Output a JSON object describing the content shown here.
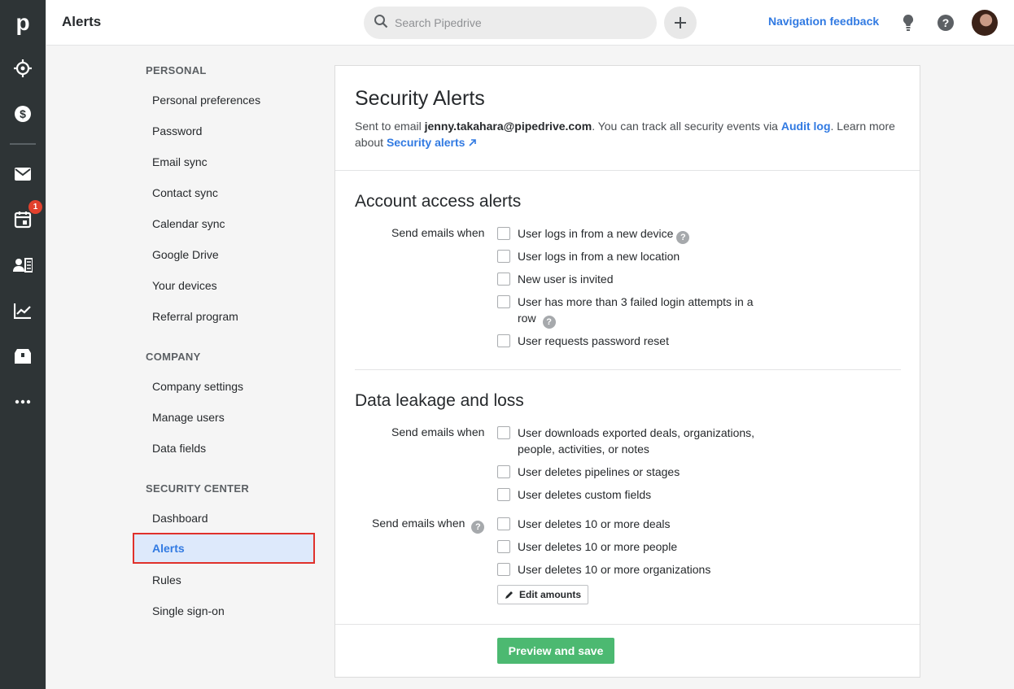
{
  "rail": {
    "logo": "p",
    "notification_count": "1"
  },
  "header": {
    "title": "Alerts",
    "search_placeholder": "Search Pipedrive",
    "nav_feedback": "Navigation feedback"
  },
  "settings_nav": {
    "sections": [
      {
        "title": "PERSONAL",
        "items": [
          "Personal preferences",
          "Password",
          "Email sync",
          "Contact sync",
          "Calendar sync",
          "Google Drive",
          "Your devices",
          "Referral program"
        ]
      },
      {
        "title": "COMPANY",
        "items": [
          "Company settings",
          "Manage users",
          "Data fields"
        ]
      },
      {
        "title": "SECURITY CENTER",
        "items": [
          "Dashboard",
          "Alerts",
          "Rules",
          "Single sign-on"
        ]
      }
    ],
    "active_item": "Alerts"
  },
  "panel": {
    "title": "Security Alerts",
    "desc_prefix": "Sent to email ",
    "email": "jenny.takahara@pipedrive.com",
    "desc_middle": ". You can track all security events via ",
    "audit_link": "Audit log",
    "desc_after_audit": ". Learn more about ",
    "security_alerts_link": "Security alerts",
    "account_access": {
      "title": "Account access alerts",
      "send_label": "Send emails when",
      "options": [
        "User logs in from a new device",
        "User logs in from a new location",
        "New user is invited",
        "User has more than 3 failed login attempts in a row",
        "User requests password reset"
      ]
    },
    "data_leakage": {
      "title": "Data leakage and loss",
      "send_label_1": "Send emails when",
      "options_1": [
        "User downloads exported deals, organizations, people, activities, or notes",
        "User deletes pipelines or stages",
        "User deletes custom fields"
      ],
      "send_label_2": "Send emails when",
      "options_2": [
        "User deletes 10 or more deals",
        "User deletes 10 or more people",
        "User deletes 10 or more organizations"
      ],
      "edit_button": "Edit amounts"
    },
    "save_button": "Preview and save"
  }
}
